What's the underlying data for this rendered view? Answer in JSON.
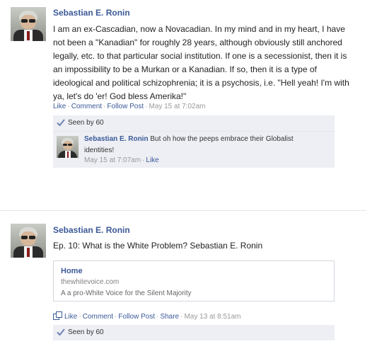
{
  "posts": [
    {
      "author": "Sebastian E. Ronin",
      "text": "I am an ex-Cascadian, now a Novacadian. In my mind and in my heart, I have not been a \"Kanadian\" for roughly 28 years, although obviously still anchored legally, etc. to that particular social institution. If one is a secessionist, then it is an impossibility to be a Murkan or a Kanadian. If so, then it is a type of ideological and political schizophrenia; it is a psychosis, i.e. \"Hell yeah! I'm with ya, let's do 'er! God bless Amerika!\"",
      "actions": {
        "like": "Like",
        "comment": "Comment",
        "follow": "Follow Post",
        "timestamp": "May 15 at 7:02am"
      },
      "seen": "Seen by 60",
      "comment": {
        "author": "Sebastian E. Ronin",
        "text": "But oh how the peeps embrace their Globalist identities!",
        "timestamp": "May 15 at 7:07am",
        "like": "Like"
      }
    },
    {
      "author": "Sebastian E. Ronin",
      "text": "Ep. 10: What is the White Problem? Sebastian E. Ronin",
      "link_card": {
        "title": "Home",
        "domain": "thewhitevoice.com",
        "description": "A a pro-White Voice for the Silent Majority"
      },
      "actions": {
        "like": "Like",
        "comment": "Comment",
        "follow": "Follow Post",
        "share": "Share",
        "timestamp": "May 13 at 8:51am"
      },
      "seen": "Seen by 60"
    }
  ],
  "icons": {
    "seen": "checkmark-icon",
    "share": "share-icon",
    "avatar": "profile-photo"
  },
  "colors": {
    "link": "#3b5998",
    "meta": "#999999",
    "panel": "#edeff4"
  }
}
